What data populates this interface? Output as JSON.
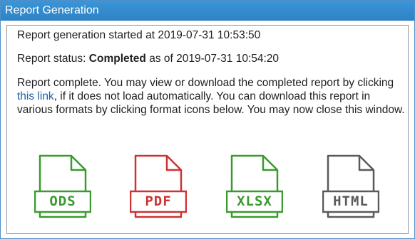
{
  "window": {
    "title": "Report Generation"
  },
  "report": {
    "started_prefix": "Report generation started at ",
    "started_time": "2019-07-31 10:53:50",
    "status_prefix": "Report status: ",
    "status_value": "Completed",
    "status_mid": " as of ",
    "status_time": "2019-07-31 10:54:20",
    "message_before_link": "Report complete. You may view or download the completed report by clicking ",
    "link_text": "this link",
    "message_after_link": ", if it does not load automatically. You can download this report in various formats by clicking format icons below. You may now close this window."
  },
  "formats": [
    {
      "label": "ODS",
      "color": "#3a9a2f",
      "icon": "ods-file-icon"
    },
    {
      "label": "PDF",
      "color": "#cc3333",
      "icon": "pdf-file-icon"
    },
    {
      "label": "XLSX",
      "color": "#3a9a2f",
      "icon": "xlsx-file-icon"
    },
    {
      "label": "HTML",
      "color": "#5a5a5a",
      "icon": "html-file-icon"
    }
  ]
}
